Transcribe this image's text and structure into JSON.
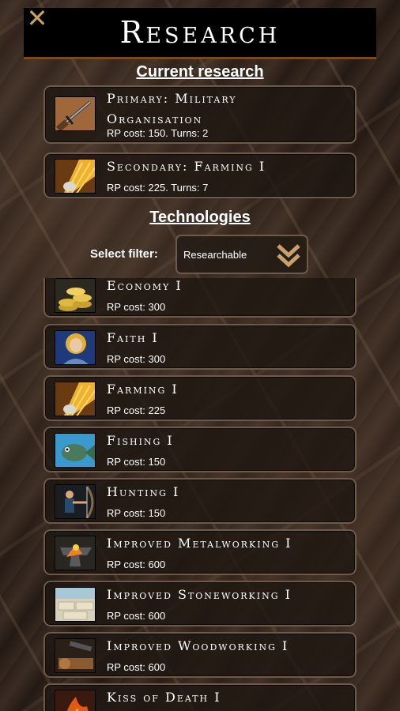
{
  "header": {
    "title": "Research",
    "close_icon": "close-x-icon"
  },
  "current_section": {
    "title": "Current research"
  },
  "current": [
    {
      "name_line1": "Primary: Military",
      "name_line2": "Organisation",
      "cost": "RP cost: 150. Turns: 2",
      "icon": "sword-icon"
    },
    {
      "name_line1": "Secondary: Farming I",
      "cost": "RP cost: 225. Turns: 7",
      "icon": "wheat-icon"
    }
  ],
  "tech_section": {
    "title": "Technologies"
  },
  "filter": {
    "label": "Select filter:",
    "value": "Researchable",
    "icon": "double-chevron-down-icon"
  },
  "technologies": [
    {
      "name": "Economy I",
      "cost": "RP cost: 300",
      "icon": "coins-icon"
    },
    {
      "name": "Faith I",
      "cost": "RP cost: 300",
      "icon": "saint-icon"
    },
    {
      "name": "Farming I",
      "cost": "RP cost: 225",
      "icon": "wheat-icon"
    },
    {
      "name": "Fishing I",
      "cost": "RP cost: 150",
      "icon": "fish-icon"
    },
    {
      "name": "Hunting I",
      "cost": "RP cost: 150",
      "icon": "archer-icon"
    },
    {
      "name": "Improved Metalworking I",
      "cost": "RP cost: 600",
      "icon": "anvil-icon"
    },
    {
      "name": "Improved Stoneworking I",
      "cost": "RP cost: 600",
      "icon": "stone-icon"
    },
    {
      "name": "Improved Woodworking I",
      "cost": "RP cost: 600",
      "icon": "saw-icon"
    },
    {
      "name": "Kiss of Death I",
      "cost": "",
      "icon": "fire-icon"
    }
  ],
  "colors": {
    "card_border": "#6e5a48",
    "header_bg": "#000000",
    "accent": "#c9a06a"
  }
}
